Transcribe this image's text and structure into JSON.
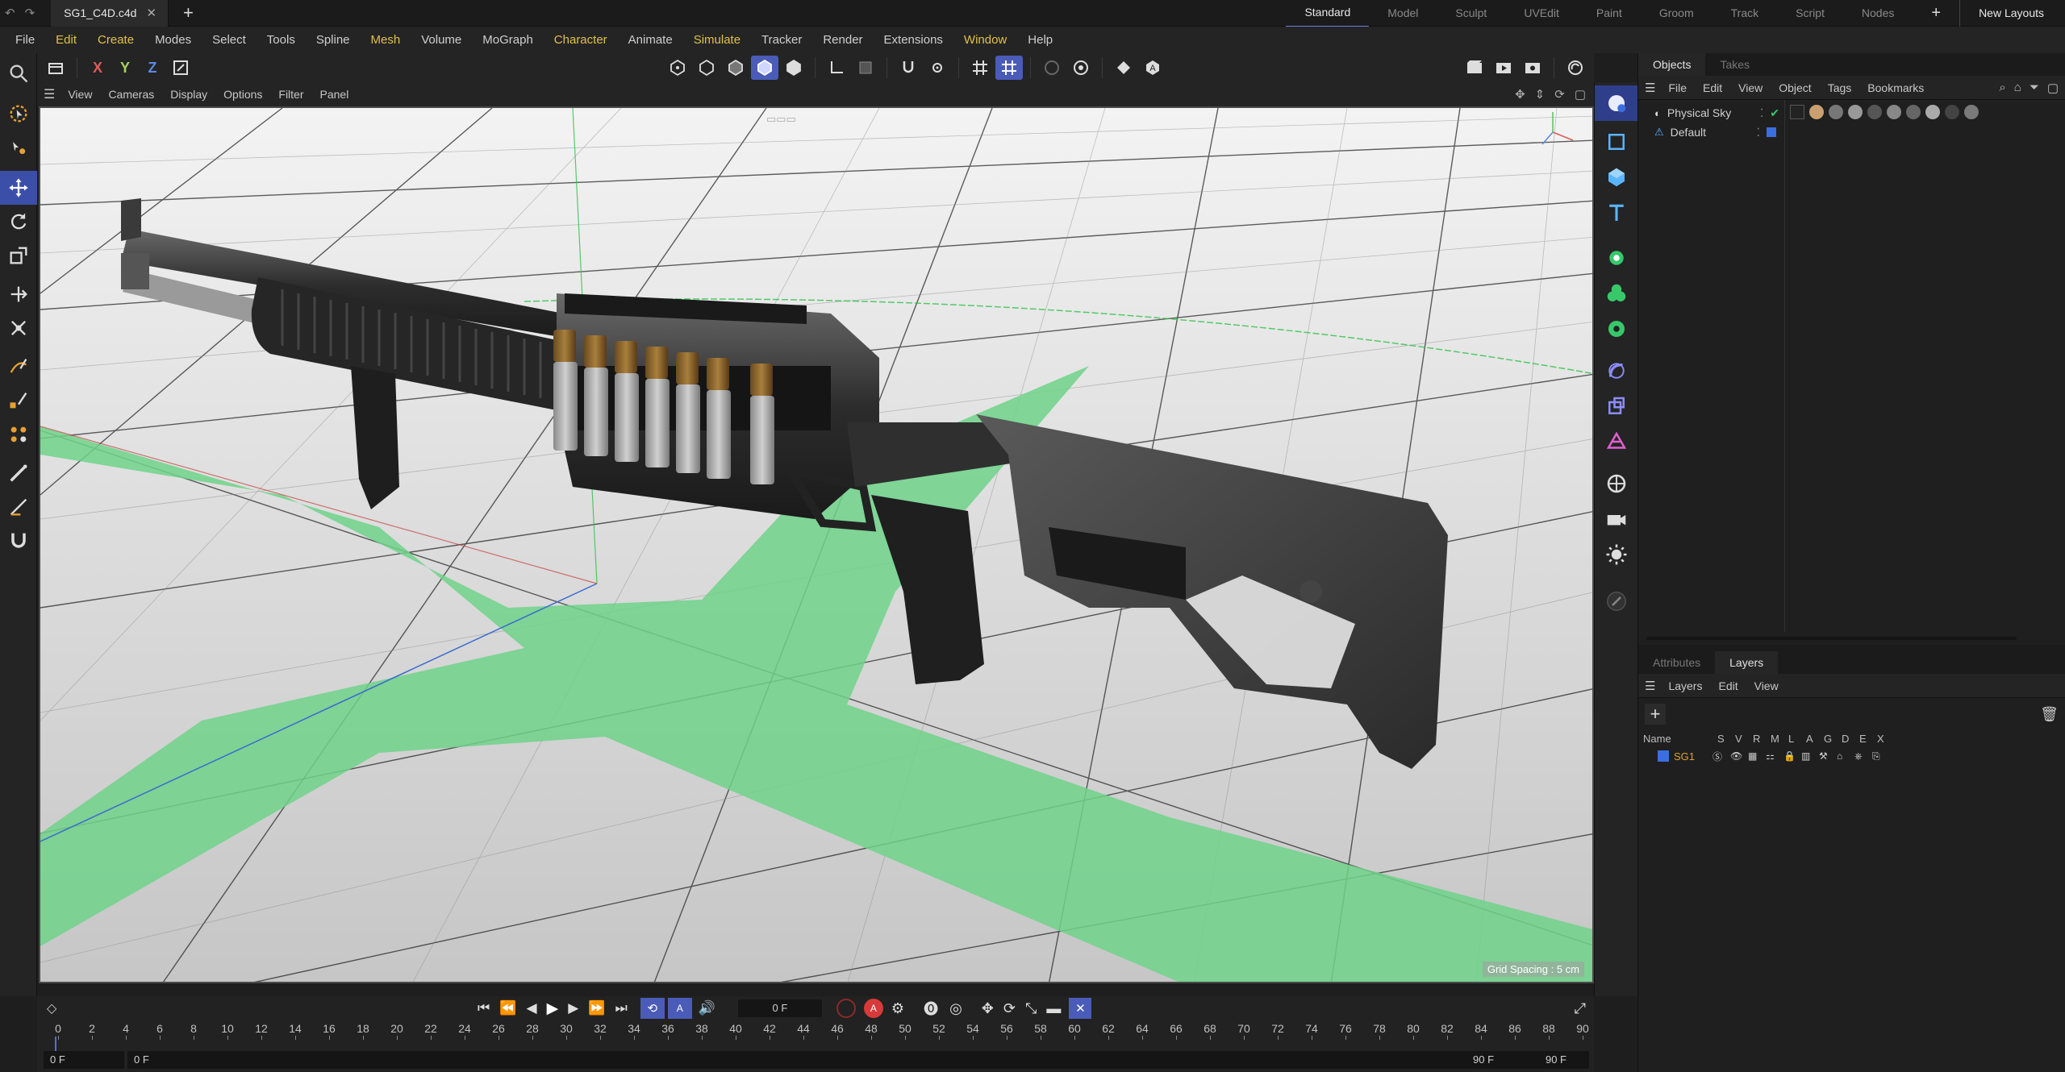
{
  "titlebar": {
    "doc_tab": "SG1_C4D.c4d",
    "layouts": [
      "Standard",
      "Model",
      "Sculpt",
      "UVEdit",
      "Paint",
      "Groom",
      "Track",
      "Script",
      "Nodes"
    ],
    "active_layout": "Standard",
    "new_layouts": "New Layouts"
  },
  "menubar": [
    "File",
    "Edit",
    "Create",
    "Modes",
    "Select",
    "Tools",
    "Spline",
    "Mesh",
    "Volume",
    "MoGraph",
    "Character",
    "Animate",
    "Simulate",
    "Tracker",
    "Render",
    "Extensions",
    "Window",
    "Help"
  ],
  "menubar_highlighted": [
    "Edit",
    "Create",
    "Mesh",
    "Character",
    "Simulate",
    "Window"
  ],
  "viewport": {
    "menu": [
      "View",
      "Cameras",
      "Display",
      "Options",
      "Filter",
      "Panel"
    ],
    "grid_spacing": "Grid Spacing : 5 cm"
  },
  "objects_panel": {
    "tabs": [
      "Objects",
      "Takes"
    ],
    "menu": [
      "File",
      "Edit",
      "View",
      "Object",
      "Tags",
      "Bookmarks"
    ],
    "items": [
      {
        "name": "Physical Sky"
      },
      {
        "name": "Default"
      }
    ]
  },
  "layers_panel": {
    "tabs": [
      "Attributes",
      "Layers"
    ],
    "menu": [
      "Layers",
      "Edit",
      "View"
    ],
    "header_name": "Name",
    "header_flags": [
      "S",
      "V",
      "R",
      "M",
      "L",
      "A",
      "G",
      "D",
      "E",
      "X"
    ],
    "layers": [
      {
        "name": "SG1",
        "color": "#3b6fe0"
      }
    ]
  },
  "timeline": {
    "current_frame": "0 F",
    "ticks": [
      "0",
      "2",
      "4",
      "6",
      "8",
      "10",
      "12",
      "14",
      "16",
      "18",
      "20",
      "22",
      "24",
      "26",
      "28",
      "30",
      "32",
      "34",
      "36",
      "38",
      "40",
      "42",
      "44",
      "46",
      "48",
      "50",
      "52",
      "54",
      "56",
      "58",
      "60",
      "62",
      "64",
      "66",
      "68",
      "70",
      "72",
      "74",
      "76",
      "78",
      "80",
      "82",
      "84",
      "86",
      "88",
      "90"
    ],
    "start_field": "0 F",
    "range_start": "0 F",
    "range_end": "90 F",
    "end_field": "90 F"
  },
  "colors": {
    "accent": "#4a5cb8",
    "menu_highlight": "#e0c14a",
    "grid_green": "#6fd28a",
    "layer_name": "#e0a030"
  }
}
